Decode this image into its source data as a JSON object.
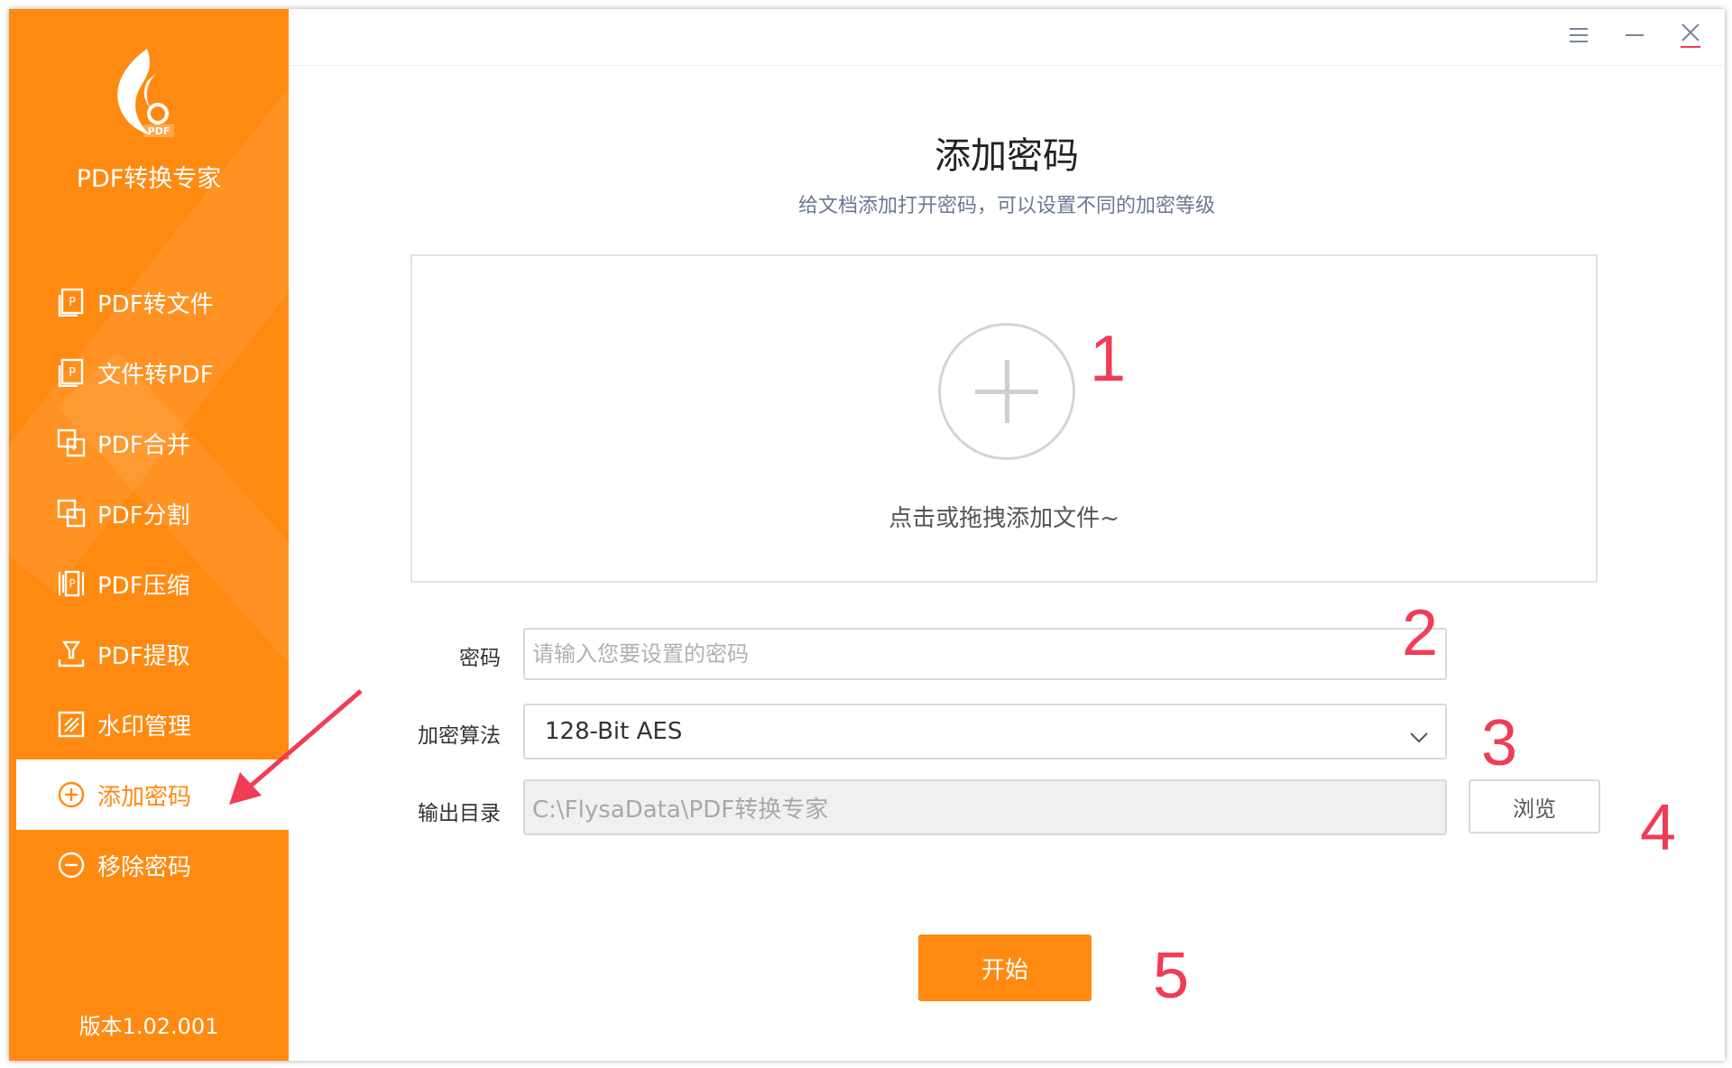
{
  "app": {
    "name": "PDF转换专家",
    "logo_text": "PDF",
    "version": "版本1.02.001",
    "accent_color": "#ff8a12"
  },
  "sidebar": {
    "items": [
      {
        "label": "PDF转文件",
        "icon": "pdf-to-file-icon",
        "active": false
      },
      {
        "label": "文件转PDF",
        "icon": "file-to-pdf-icon",
        "active": false
      },
      {
        "label": "PDF合并",
        "icon": "merge-icon",
        "active": false
      },
      {
        "label": "PDF分割",
        "icon": "split-icon",
        "active": false
      },
      {
        "label": "PDF压缩",
        "icon": "compress-icon",
        "active": false
      },
      {
        "label": "PDF提取",
        "icon": "extract-icon",
        "active": false
      },
      {
        "label": "水印管理",
        "icon": "watermark-icon",
        "active": false
      },
      {
        "label": "添加密码",
        "icon": "plus-circle-icon",
        "active": true
      },
      {
        "label": "移除密码",
        "icon": "minus-circle-icon",
        "active": false
      }
    ]
  },
  "window_controls": [
    "menu-icon",
    "minimize-icon",
    "close-icon"
  ],
  "main": {
    "title": "添加密码",
    "subtitle": "给文档添加打开密码，可以设置不同的加密等级",
    "dropzone_hint": "点击或拖拽添加文件~",
    "form": {
      "password_label": "密码",
      "password_placeholder": "请输入您要设置的密码",
      "password_value": "",
      "algorithm_label": "加密算法",
      "algorithm_value": "128-Bit AES",
      "output_label": "输出目录",
      "output_value": "C:\\FlysaData\\PDF转换专家",
      "browse_label": "浏览"
    },
    "start_label": "开始"
  },
  "annotations": {
    "markers": [
      "1",
      "2",
      "3",
      "4",
      "5"
    ],
    "marker_color": "#f03c55"
  }
}
